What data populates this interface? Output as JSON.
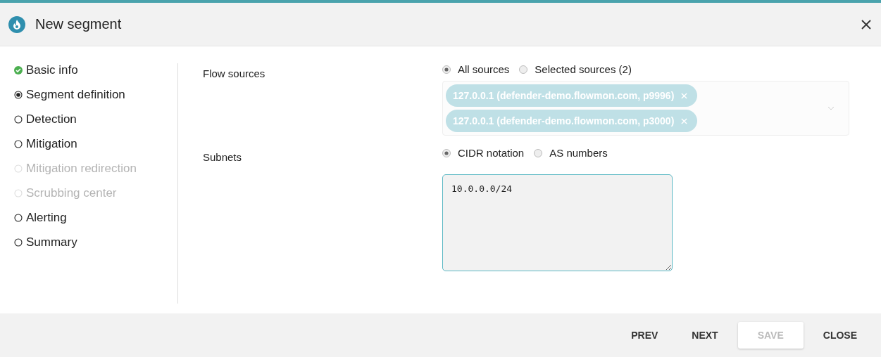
{
  "dialog": {
    "title": "New segment"
  },
  "steps": [
    {
      "label": "Basic info",
      "kind": "done"
    },
    {
      "label": "Segment definition",
      "kind": "current"
    },
    {
      "label": "Detection",
      "kind": "todo"
    },
    {
      "label": "Mitigation",
      "kind": "todo"
    },
    {
      "label": "Mitigation redirection",
      "kind": "disabled"
    },
    {
      "label": "Scrubbing center",
      "kind": "disabled"
    },
    {
      "label": "Alerting",
      "kind": "todo"
    },
    {
      "label": "Summary",
      "kind": "todo"
    }
  ],
  "flow_sources": {
    "label": "Flow sources",
    "options": [
      {
        "label": "All sources",
        "selected": true
      },
      {
        "label": "Selected sources (2)",
        "selected": false
      }
    ],
    "chips": [
      "127.0.0.1 (defender-demo.flowmon.com, p9996)",
      "127.0.0.1 (defender-demo.flowmon.com, p3000)"
    ]
  },
  "subnets": {
    "label": "Subnets",
    "options": [
      {
        "label": "CIDR notation",
        "selected": true
      },
      {
        "label": "AS numbers",
        "selected": false
      }
    ],
    "value": "10.0.0.0/24"
  },
  "buttons": [
    {
      "label": "PREV",
      "disabled": false
    },
    {
      "label": "NEXT",
      "disabled": false
    },
    {
      "label": "SAVE",
      "disabled": true
    },
    {
      "label": "CLOSE",
      "disabled": false
    }
  ]
}
